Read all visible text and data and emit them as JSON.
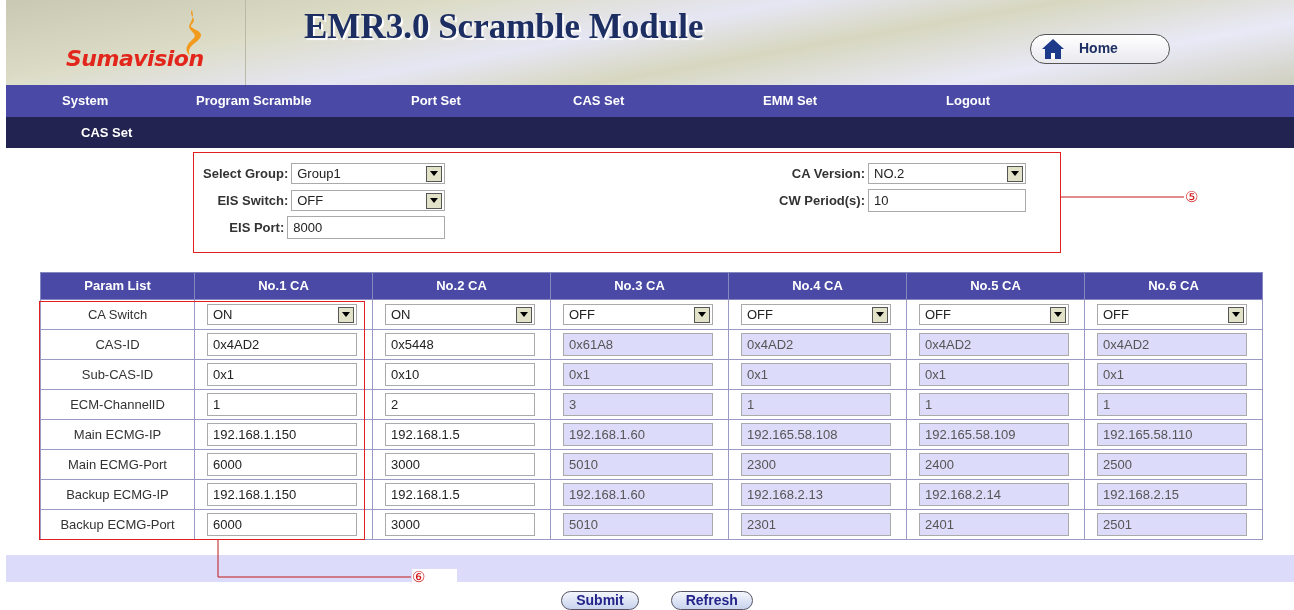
{
  "header": {
    "logo": "Sumavision",
    "title": "EMR3.0  Scramble  Module",
    "home_button": "Home"
  },
  "nav": [
    {
      "label": "System"
    },
    {
      "label": "Program Scramble"
    },
    {
      "label": "Port Set"
    },
    {
      "label": "CAS Set"
    },
    {
      "label": "EMM Set"
    },
    {
      "label": "Logout"
    }
  ],
  "subnav": {
    "label": "CAS Set"
  },
  "form": {
    "left": [
      {
        "label": "Select Group:",
        "kind": "select",
        "value": "Group1"
      },
      {
        "label": "EIS Switch:",
        "kind": "select",
        "value": "OFF"
      },
      {
        "label": "EIS Port:",
        "kind": "input",
        "value": "8000"
      }
    ],
    "right": [
      {
        "label": "CA Version:",
        "kind": "select",
        "value": "NO.2"
      },
      {
        "label": "CW Period(s):",
        "kind": "input",
        "value": "10"
      }
    ]
  },
  "annotations": [
    "⑤",
    "⑥"
  ],
  "table": {
    "columns": [
      "Param List",
      "No.1 CA",
      "No.2 CA",
      "No.3 CA",
      "No.4 CA",
      "No.5 CA",
      "No.6 CA"
    ],
    "rows": [
      {
        "cells": [
          {
            "kind": "label",
            "value": "CA Switch"
          },
          {
            "kind": "select",
            "value": "ON",
            "disabled": false
          },
          {
            "kind": "select",
            "value": "ON",
            "disabled": false
          },
          {
            "kind": "select",
            "value": "OFF",
            "disabled": false
          },
          {
            "kind": "select",
            "value": "OFF",
            "disabled": false
          },
          {
            "kind": "select",
            "value": "OFF",
            "disabled": false
          },
          {
            "kind": "select",
            "value": "OFF",
            "disabled": false
          }
        ]
      },
      {
        "cells": [
          {
            "kind": "label",
            "value": "CAS-ID"
          },
          {
            "kind": "input",
            "value": "0x4AD2",
            "disabled": false
          },
          {
            "kind": "input",
            "value": "0x5448",
            "disabled": false
          },
          {
            "kind": "input",
            "value": "0x61A8",
            "disabled": true
          },
          {
            "kind": "input",
            "value": "0x4AD2",
            "disabled": true
          },
          {
            "kind": "input",
            "value": "0x4AD2",
            "disabled": true
          },
          {
            "kind": "input",
            "value": "0x4AD2",
            "disabled": true
          }
        ]
      },
      {
        "cells": [
          {
            "kind": "label",
            "value": "Sub-CAS-ID"
          },
          {
            "kind": "input",
            "value": "0x1",
            "disabled": false
          },
          {
            "kind": "input",
            "value": "0x10",
            "disabled": false
          },
          {
            "kind": "input",
            "value": "0x1",
            "disabled": true
          },
          {
            "kind": "input",
            "value": "0x1",
            "disabled": true
          },
          {
            "kind": "input",
            "value": "0x1",
            "disabled": true
          },
          {
            "kind": "input",
            "value": "0x1",
            "disabled": true
          }
        ]
      },
      {
        "cells": [
          {
            "kind": "label",
            "value": "ECM-ChannelID"
          },
          {
            "kind": "input",
            "value": "1",
            "disabled": false
          },
          {
            "kind": "input",
            "value": "2",
            "disabled": false
          },
          {
            "kind": "input",
            "value": "3",
            "disabled": true
          },
          {
            "kind": "input",
            "value": "1",
            "disabled": true
          },
          {
            "kind": "input",
            "value": "1",
            "disabled": true
          },
          {
            "kind": "input",
            "value": "1",
            "disabled": true
          }
        ]
      },
      {
        "cells": [
          {
            "kind": "label",
            "value": "Main ECMG-IP"
          },
          {
            "kind": "input",
            "value": "192.168.1.150",
            "disabled": false
          },
          {
            "kind": "input",
            "value": "192.168.1.5",
            "disabled": false
          },
          {
            "kind": "input",
            "value": "192.168.1.60",
            "disabled": true
          },
          {
            "kind": "input",
            "value": "192.165.58.108",
            "disabled": true
          },
          {
            "kind": "input",
            "value": "192.165.58.109",
            "disabled": true
          },
          {
            "kind": "input",
            "value": "192.165.58.110",
            "disabled": true
          }
        ]
      },
      {
        "cells": [
          {
            "kind": "label",
            "value": "Main ECMG-Port"
          },
          {
            "kind": "input",
            "value": "6000",
            "disabled": false
          },
          {
            "kind": "input",
            "value": "3000",
            "disabled": false
          },
          {
            "kind": "input",
            "value": "5010",
            "disabled": true
          },
          {
            "kind": "input",
            "value": "2300",
            "disabled": true
          },
          {
            "kind": "input",
            "value": "2400",
            "disabled": true
          },
          {
            "kind": "input",
            "value": "2500",
            "disabled": true
          }
        ]
      },
      {
        "cells": [
          {
            "kind": "label",
            "value": "Backup ECMG-IP"
          },
          {
            "kind": "input",
            "value": "192.168.1.150",
            "disabled": false
          },
          {
            "kind": "input",
            "value": "192.168.1.5",
            "disabled": false
          },
          {
            "kind": "input",
            "value": "192.168.1.60",
            "disabled": true
          },
          {
            "kind": "input",
            "value": "192.168.2.13",
            "disabled": true
          },
          {
            "kind": "input",
            "value": "192.168.2.14",
            "disabled": true
          },
          {
            "kind": "input",
            "value": "192.168.2.15",
            "disabled": true
          }
        ]
      },
      {
        "cells": [
          {
            "kind": "label",
            "value": "Backup ECMG-Port"
          },
          {
            "kind": "input",
            "value": "6000",
            "disabled": false
          },
          {
            "kind": "input",
            "value": "3000",
            "disabled": false
          },
          {
            "kind": "input",
            "value": "5010",
            "disabled": true
          },
          {
            "kind": "input",
            "value": "2301",
            "disabled": true
          },
          {
            "kind": "input",
            "value": "2401",
            "disabled": true
          },
          {
            "kind": "input",
            "value": "2501",
            "disabled": true
          }
        ]
      }
    ]
  },
  "buttons": [
    "Submit",
    "Refresh"
  ]
}
